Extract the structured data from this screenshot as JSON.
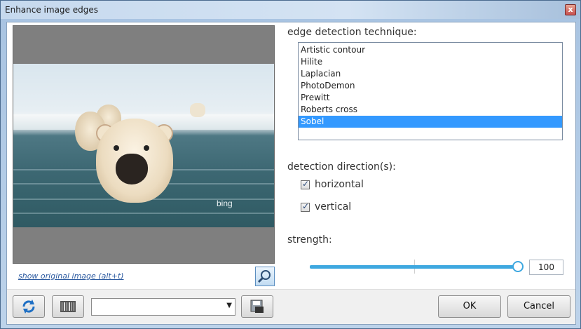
{
  "window": {
    "title": "Enhance image edges",
    "close_glyph": "x"
  },
  "preview": {
    "watermark": "bing",
    "show_original_link": "show original image (alt+t)"
  },
  "technique": {
    "label": "edge detection technique:",
    "items": [
      "Artistic contour",
      "Hilite",
      "Laplacian",
      "PhotoDemon",
      "Prewitt",
      "Roberts cross",
      "Sobel"
    ],
    "selected_index": 6
  },
  "direction": {
    "label": "detection direction(s):",
    "horizontal_label": "horizontal",
    "horizontal_checked": true,
    "vertical_label": "vertical",
    "vertical_checked": true
  },
  "strength": {
    "label": "strength:",
    "value": "100",
    "slider_fraction": 1.0
  },
  "footer": {
    "preset_value": "",
    "ok_label": "OK",
    "cancel_label": "Cancel"
  },
  "icons": {
    "reset": "refresh-icon",
    "randomize": "barcode-icon",
    "save_preset": "save-preset-icon",
    "zoom": "zoom-icon"
  },
  "colors": {
    "selection": "#3399ff",
    "slider": "#3ea8e0",
    "link": "#2c5aa0"
  }
}
